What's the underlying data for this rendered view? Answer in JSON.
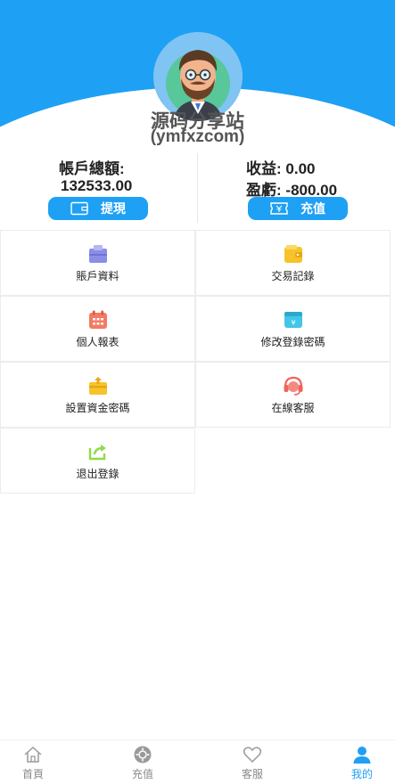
{
  "profile": {
    "site_name": "源码分享站",
    "site_name_sub": "(ymfxzcom)"
  },
  "account": {
    "balance_label": "帳戶總額:",
    "balance_value": "132533.00",
    "profit_label": "收益:",
    "profit_value": "0.00",
    "loss_label": "盈虧:",
    "loss_value": "-800.00",
    "withdraw_label": "提現",
    "deposit_label": "充值"
  },
  "menu": [
    {
      "label": "賬戶資料",
      "icon": "profile-card-icon"
    },
    {
      "label": "交易記錄",
      "icon": "wallet-icon"
    },
    {
      "label": "個人報表",
      "icon": "calendar-icon"
    },
    {
      "label": "修改登錄密碼",
      "icon": "yen-card-icon"
    },
    {
      "label": "設置資金密碼",
      "icon": "fund-card-icon"
    },
    {
      "label": "在線客服",
      "icon": "headset-icon"
    },
    {
      "label": "退出登錄",
      "icon": "share-exit-icon"
    }
  ],
  "tabs": [
    {
      "label": "首頁",
      "icon": "home-icon"
    },
    {
      "label": "充值",
      "icon": "recharge-icon"
    },
    {
      "label": "客服",
      "icon": "heart-icon"
    },
    {
      "label": "我的",
      "icon": "user-icon"
    }
  ],
  "colors": {
    "primary": "#1ea0f5",
    "menu_icon_purple": "#8b8ee6",
    "menu_icon_yellow": "#f7c32b",
    "menu_icon_coral": "#f27b63",
    "menu_icon_cyan": "#41c6e8",
    "menu_icon_red": "#f2645b",
    "menu_icon_green": "#8fdb4a"
  }
}
